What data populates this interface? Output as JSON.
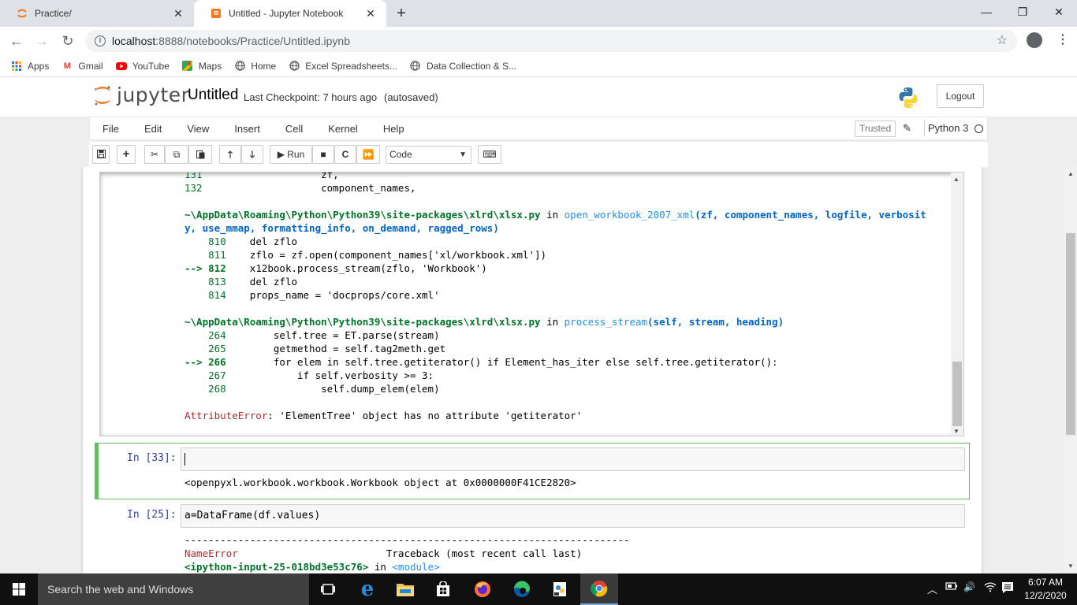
{
  "browser": {
    "tabs": [
      {
        "title": "Practice/",
        "active": false
      },
      {
        "title": "Untitled - Jupyter Notebook",
        "active": true
      }
    ],
    "new_tab": "+",
    "window_controls": {
      "minimize": "—",
      "maximize": "❐",
      "close": "✕"
    },
    "url_host": "localhost",
    "url_path": ":8888/notebooks/Practice/Untitled.ipynb",
    "bookmarks": [
      {
        "label": "Apps",
        "icon": "apps-grid-icon"
      },
      {
        "label": "Gmail",
        "icon": "gmail-icon"
      },
      {
        "label": "YouTube",
        "icon": "youtube-icon"
      },
      {
        "label": "Maps",
        "icon": "maps-icon"
      },
      {
        "label": "Home",
        "icon": "globe-icon"
      },
      {
        "label": "Excel Spreadsheets...",
        "icon": "globe-icon"
      },
      {
        "label": "Data Collection & S...",
        "icon": "globe-icon"
      }
    ]
  },
  "jupyter": {
    "logo_text": "jupyter",
    "notebook_name": "Untitled",
    "checkpoint": "Last Checkpoint: 7 hours ago",
    "autosaved": "(autosaved)",
    "logout": "Logout",
    "menu": [
      "File",
      "Edit",
      "View",
      "Insert",
      "Cell",
      "Kernel",
      "Help"
    ],
    "trusted": "Trusted",
    "kernel_name": "Python 3",
    "toolbar": {
      "run_label": "Run",
      "cell_type": "Code"
    }
  },
  "traceback": {
    "lines": [
      {
        "num": "131",
        "code": "                zf,",
        "arrow": false
      },
      {
        "num": "132",
        "code": "                component_names,",
        "arrow": false
      }
    ],
    "frame1_path": "~\\AppData\\Roaming\\Python\\Python39\\site-packages\\xlrd\\xlsx.py",
    "frame1_in": " in ",
    "frame1_func": "open_workbook_2007_xml",
    "frame1_args_a": "(zf, component_names, logfile, verbosit",
    "frame1_args_b": "y, use_mmap, formatting_info, on_demand, ragged_rows)",
    "frame1_lines": [
      {
        "prefix": "    810",
        "code": "    del zflo"
      },
      {
        "prefix": "    811",
        "code": "    zflo = zf.open(component_names['xl/workbook.xml'])"
      },
      {
        "prefix": "--> 812",
        "code": "    x12book.process_stream(zflo, 'Workbook')"
      },
      {
        "prefix": "    813",
        "code": "    del zflo"
      },
      {
        "prefix": "    814",
        "code": "    props_name = 'docprops/core.xml'"
      }
    ],
    "frame2_path": "~\\AppData\\Roaming\\Python\\Python39\\site-packages\\xlrd\\xlsx.py",
    "frame2_in": " in ",
    "frame2_func": "process_stream",
    "frame2_args": "(self, stream, heading)",
    "frame2_lines": [
      {
        "prefix": "    264",
        "code": "        self.tree = ET.parse(stream)"
      },
      {
        "prefix": "    265",
        "code": "        getmethod = self.tag2meth.get"
      },
      {
        "prefix": "--> 266",
        "code": "        for elem in self.tree.getiterator() if Element_has_iter else self.tree.getiterator():"
      },
      {
        "prefix": "    267",
        "code": "            if self.verbosity >= 3:"
      },
      {
        "prefix": "    268",
        "code": "                self.dump_elem(elem)"
      }
    ],
    "error_name": "AttributeError",
    "error_msg": ": 'ElementTree' object has no attribute 'getiterator'"
  },
  "cells": [
    {
      "prompt": "In [33]:",
      "input": "",
      "output": "<openpyxl.workbook.workbook.Workbook object at 0x0000000F41CE2820>"
    },
    {
      "prompt": "In [25]:",
      "input": "a=DataFrame(df.values)",
      "dashes": "---------------------------------------------------------------------------",
      "error_name": "NameError",
      "traceback_label": "                         Traceback (most recent call last)",
      "input_ref": "<ipython-input-25-018bd3e53c76>",
      "in_word": " in ",
      "module": "<module>"
    }
  ],
  "taskbar": {
    "search_placeholder": "Search the web and Windows",
    "time": "6:07 AM",
    "date": "12/2/2020"
  }
}
